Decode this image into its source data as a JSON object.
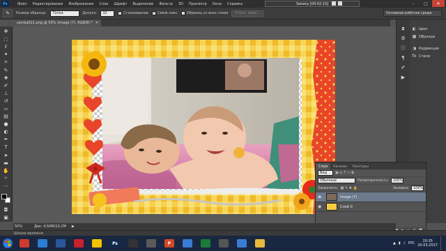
{
  "menubar": {
    "logo": "Ps",
    "items": [
      "Файл",
      "Редактирование",
      "Изображение",
      "Слои",
      "Шрифт",
      "Выделение",
      "Фильтр",
      "3D",
      "Просмотр",
      "Окно",
      "Справка"
    ],
    "recording": "Запись [00:02:10]"
  },
  "options": {
    "sample_size_label": "Размер образца:",
    "sample_size_value": "Точка",
    "tolerance_label": "Допуск:",
    "tolerance_value": "32",
    "antialias_label": "Сглаживание",
    "contiguous_label": "Смеж.пикс",
    "sample_all_label": "Образец со всех слоев",
    "refine_edge_label": "Уточн. край...",
    "workspace": "Основная рабочая среда"
  },
  "document": {
    "tab_title": "zamka021.png @ 50% (image (7), RGB/8) *"
  },
  "right_panels": {
    "items": [
      {
        "icon": "color-icon",
        "label": "Цвет"
      },
      {
        "icon": "swatches-icon",
        "label": "Образцы"
      },
      {
        "icon": "adjustments-icon",
        "label": "Коррекция"
      },
      {
        "icon": "styles-icon",
        "label": "Стили"
      }
    ]
  },
  "layers_panel": {
    "tabs": [
      "Слои",
      "Каналы",
      "Контуры"
    ],
    "kind_filter": "Вид",
    "blend_mode": "Обычные",
    "opacity_label": "Непрозрачность:",
    "opacity_value": "100%",
    "lock_label": "Закрепить:",
    "fill_label": "Заливка:",
    "fill_value": "100%",
    "layers": [
      {
        "name": "image (7)",
        "selected": true
      },
      {
        "name": "Слой 0",
        "selected": false
      }
    ]
  },
  "status": {
    "zoom": "50%",
    "doc_size": "Док: 4,50M/10,1M"
  },
  "timeline": {
    "label": "Шкала времени"
  },
  "taskbar": {
    "apps": [
      {
        "icon": "chrome-icon",
        "color": "#d03b2f"
      },
      {
        "icon": "ie-icon",
        "color": "#2d7dd2"
      },
      {
        "icon": "word-icon",
        "color": "#2b579a"
      },
      {
        "icon": "opera-icon",
        "color": "#cc1f2d"
      },
      {
        "icon": "archive-icon",
        "color": "#f2c300"
      },
      {
        "icon": "photoshop-icon",
        "color": "#0e2a4f"
      },
      {
        "icon": "video-icon",
        "color": "#333333"
      },
      {
        "icon": "image-icon",
        "color": "#5a5a5a"
      },
      {
        "icon": "powerpoint-icon",
        "color": "#d24726"
      },
      {
        "icon": "paint-icon",
        "color": "#3a7bd5"
      },
      {
        "icon": "media-icon",
        "color": "#1b7a3a"
      },
      {
        "icon": "player-icon",
        "color": "#555555"
      },
      {
        "icon": "mail-icon",
        "color": "#3a7bd5"
      },
      {
        "icon": "explorer-icon",
        "color": "#e8b93a"
      }
    ],
    "app_labels": [
      "",
      "",
      "",
      "",
      "",
      "Ps",
      "",
      "",
      "P",
      "",
      "",
      "",
      "",
      ""
    ],
    "lang": "РУС",
    "time": "20:35",
    "date": "20.03.2017"
  }
}
